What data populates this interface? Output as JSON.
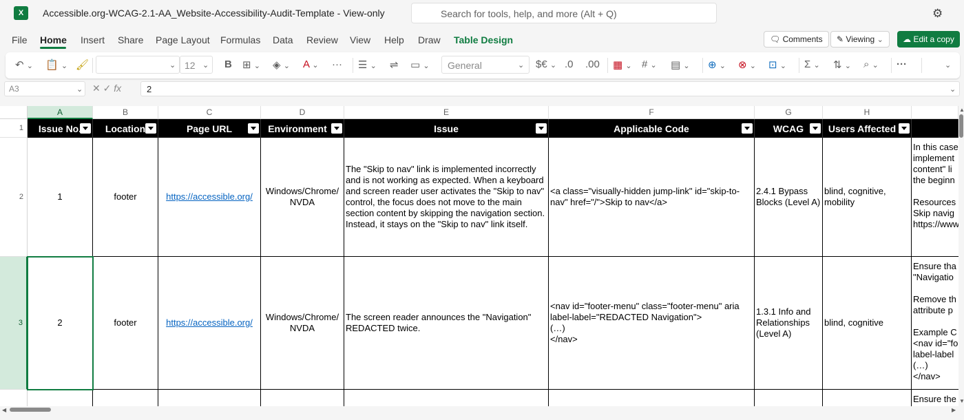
{
  "app": {
    "logo_letter": "X",
    "title": "Accessible.org-WCAG-2.1-AA_Website-Accessibility-Audit-Template  -  View-only",
    "search_placeholder": "Search for tools, help, and more (Alt + Q)"
  },
  "menu": {
    "items": [
      "File",
      "Home",
      "Insert",
      "Share",
      "Page Layout",
      "Formulas",
      "Data",
      "Review",
      "View",
      "Help",
      "Draw",
      "Table Design"
    ],
    "active": "Home",
    "comments_label": "Comments",
    "viewing_label": "Viewing",
    "edit_label": "Edit a copy"
  },
  "ribbon": {
    "font_size": "12",
    "number_format": "General",
    "bold": "B"
  },
  "formula_bar": {
    "cell_ref": "A3",
    "value": "2"
  },
  "grid": {
    "column_letters": [
      "A",
      "B",
      "C",
      "D",
      "E",
      "F",
      "G",
      "H"
    ],
    "row_numbers": [
      "1",
      "2",
      "3"
    ],
    "selected_column": "A",
    "selected_row": "3",
    "headers": [
      "Issue No.",
      "Location",
      "Page URL",
      "Environment",
      "Issue",
      "Applicable Code",
      "WCAG",
      "Users Affected"
    ],
    "rows": [
      {
        "issue_no": "1",
        "location": "footer",
        "url": "https://accessible.org/",
        "environment": "Windows/Chrome/\nNVDA",
        "issue": "The \"Skip to nav\" link is implemented incorrectly and is not working as expected. When a keyboard and screen reader user activates the \"Skip to nav\" control, the focus does not move to the main section content by skipping the navigation section. Instead, it stays on the \"Skip to nav\" link itself.",
        "code": "<a class=\"visually-hidden jump-link\" id=\"skip-to-nav\" href=\"/\">Skip to nav</a>",
        "wcag": "2.4.1 Bypass Blocks (Level A)",
        "users": "blind, cognitive, mobility",
        "overflow": "In this case\nimplement\ncontent\" li\nthe beginn\n\nResources\nSkip navig\nhttps://www"
      },
      {
        "issue_no": "2",
        "location": "footer",
        "url": "https://accessible.org/",
        "environment": "Windows/Chrome/\nNVDA",
        "issue": "The screen reader announces the \"Navigation\" REDACTED twice.",
        "code": "<nav id=\"footer-menu\" class=\"footer-menu\" aria label-label=\"REDACTED Navigation\">\n(…)\n</nav>",
        "wcag": "1.3.1 Info and Relationships (Level A)",
        "users": "blind, cognitive",
        "overflow": "Ensure tha\n\"Navigatio\n\nRemove th\nattribute p\n\nExample C\n<nav id=\"fo\nlabel-label\n(…)\n</nav>"
      }
    ],
    "next_row_overflow": "Ensure the"
  }
}
